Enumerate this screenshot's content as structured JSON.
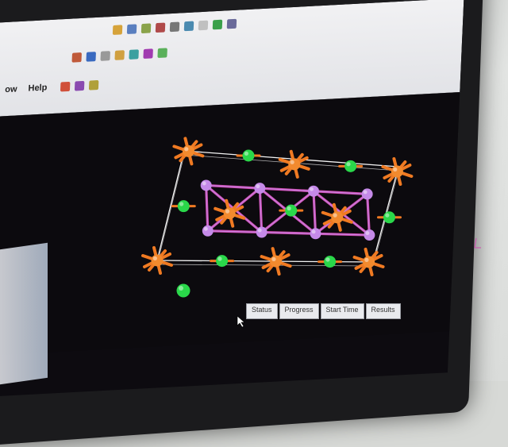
{
  "menu": {
    "items": [
      "ow",
      "Help"
    ]
  },
  "status_columns": [
    "Status",
    "Progress",
    "Start Time",
    "Results"
  ],
  "colors": {
    "background": "#0c0a0e",
    "anion_atom": "#f28a2e",
    "anion_bond": "#f07a22",
    "cation_atom": "#2ad84a",
    "metal_atom": "#c58ae8",
    "cell_edge": "#f4f4f4",
    "bond_link": "#d04ab0"
  },
  "icons": [
    "open-icon",
    "save-icon",
    "undo-icon",
    "redo-icon",
    "zoom-icon",
    "rotate-icon",
    "select-icon",
    "build-icon",
    "help-icon"
  ]
}
